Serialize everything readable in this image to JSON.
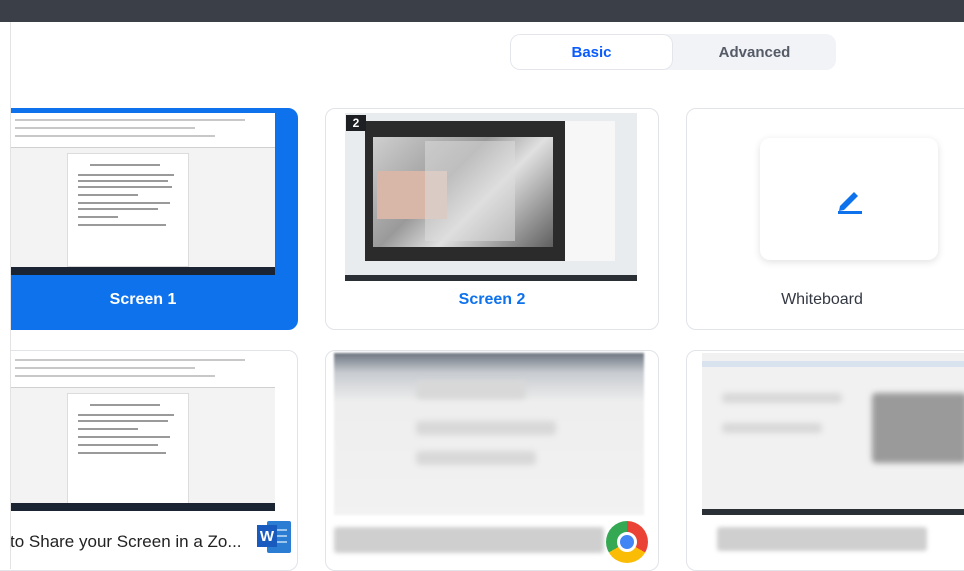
{
  "tabs": {
    "basic": "Basic",
    "advanced": "Advanced"
  },
  "tiles": [
    {
      "label": "Screen 1",
      "selected": true
    },
    {
      "label": "Screen 2",
      "badge": "2"
    },
    {
      "label": "Whiteboard"
    }
  ],
  "apps": [
    {
      "title": "to Share your Screen in a Zo...",
      "icon": "word-icon"
    },
    {
      "title": "",
      "icon": "chrome-icon"
    },
    {
      "title": "",
      "icon": ""
    }
  ],
  "colors": {
    "accent": "#0e72ed",
    "tab_active_text": "#0b5cff"
  }
}
